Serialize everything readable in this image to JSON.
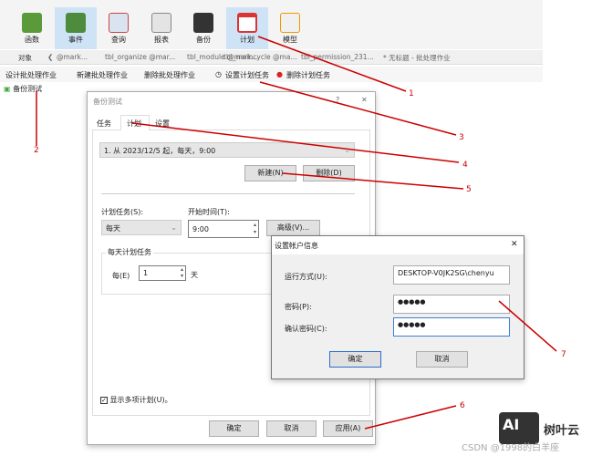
{
  "ribbon": [
    "函数",
    "事件",
    "查询",
    "报表",
    "备份",
    "计划",
    "模型"
  ],
  "tabs": {
    "object": "对象",
    "items": [
      "@mark...",
      "tbl_organize @mar...",
      "tbl_module @mark...",
      "tbl_maincycle @ma...",
      "tbl_permission_231...",
      "* 无标题 - 批处理作业"
    ]
  },
  "actions": [
    "设计批处理作业",
    "新建批处理作业",
    "删除批处理作业",
    "设置计划任务",
    "删除计划任务"
  ],
  "tree_item": "备份测试",
  "dialog1": {
    "title": "备份测试",
    "help": "?",
    "close": "✕",
    "tabs": [
      "任务",
      "计划",
      "设置"
    ],
    "schedule": "1. 从 2023/12/5 起，每天，9:00",
    "new": "新建(N)",
    "delete": "删除(D)",
    "task_label": "计划任务(S):",
    "task_value": "每天",
    "start_label": "开始时间(T):",
    "start_value": "9:00",
    "advanced": "高级(V)...",
    "group": "每天计划任务",
    "every_label": "每(E)",
    "every_value": "1",
    "unit": "天",
    "multi": "显示多项计划(U)。",
    "ok": "确定",
    "cancel": "取消",
    "apply": "应用(A)"
  },
  "dialog2": {
    "title": "设置帐户信息",
    "close": "✕",
    "run_as_label": "运行方式(U):",
    "run_as": "DESKTOP-V0JK2SG\\chenyu",
    "pw_label": "密码(P):",
    "pw": "●●●●●",
    "confirm_label": "确认密码(C):",
    "confirm": "●●●●●",
    "ok": "确定",
    "cancel": "取消"
  },
  "annotations": [
    "1",
    "2",
    "3",
    "4",
    "5",
    "6",
    "7"
  ],
  "watermark": {
    "logo": "AI",
    "brand": "树叶云",
    "csdn": "CSDN @1998的白羊座"
  }
}
